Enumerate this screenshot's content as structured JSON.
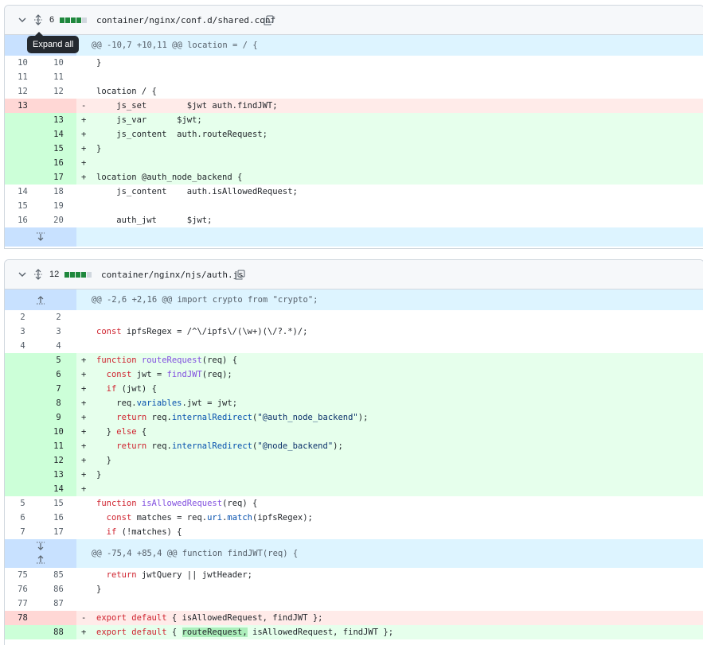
{
  "files": [
    {
      "changes": "6",
      "bars": [
        1,
        1,
        1,
        1,
        0
      ],
      "path": "container/nginx/conf.d/shared.conf",
      "tooltip": "Expand all",
      "rows": [
        {
          "type": "hunk",
          "left": "",
          "right": "",
          "sign": "",
          "code": "@@ -10,7 +10,11 @@ location = / {",
          "gutter_icon": "expand-up-icon"
        },
        {
          "type": "ctx",
          "left": "10",
          "right": "10",
          "sign": " ",
          "code": "}"
        },
        {
          "type": "ctx",
          "left": "11",
          "right": "11",
          "sign": " ",
          "code": ""
        },
        {
          "type": "ctx",
          "left": "12",
          "right": "12",
          "sign": " ",
          "code": "location / {"
        },
        {
          "type": "del",
          "left": "13",
          "right": "",
          "sign": "-",
          "code": "    js_set        $jwt auth.findJWT;"
        },
        {
          "type": "add",
          "left": "",
          "right": "13",
          "sign": "+",
          "code": "    js_var      $jwt;"
        },
        {
          "type": "add",
          "left": "",
          "right": "14",
          "sign": "+",
          "code": "    js_content  auth.routeRequest;"
        },
        {
          "type": "add",
          "left": "",
          "right": "15",
          "sign": "+",
          "code": "}"
        },
        {
          "type": "add",
          "left": "",
          "right": "16",
          "sign": "+",
          "code": ""
        },
        {
          "type": "add",
          "left": "",
          "right": "17",
          "sign": "+",
          "code": "location @auth_node_backend {"
        },
        {
          "type": "ctx",
          "left": "14",
          "right": "18",
          "sign": " ",
          "code": "    js_content    auth.isAllowedRequest;"
        },
        {
          "type": "ctx",
          "left": "15",
          "right": "19",
          "sign": " ",
          "code": ""
        },
        {
          "type": "ctx",
          "left": "16",
          "right": "20",
          "sign": " ",
          "code": "    auth_jwt      $jwt;"
        },
        {
          "type": "hunk",
          "left": "",
          "right": "",
          "sign": "",
          "code": "",
          "gutter_icon": "expand-down-icon"
        }
      ]
    },
    {
      "changes": "12",
      "bars": [
        1,
        1,
        1,
        1,
        0
      ],
      "path": "container/nginx/njs/auth.js",
      "rows": [
        {
          "type": "hunk",
          "left": "",
          "right": "",
          "sign": "",
          "code": "@@ -2,6 +2,16 @@ import crypto from \"crypto\";",
          "gutter_icon": "expand-up-icon"
        },
        {
          "type": "ctx",
          "left": "2",
          "right": "2",
          "sign": " ",
          "code": ""
        },
        {
          "type": "ctx",
          "left": "3",
          "right": "3",
          "sign": " ",
          "code": "const ipfsRegex = /^\\/ipfs\\/(\\w+)(\\/?.*)/;"
        },
        {
          "type": "ctx",
          "left": "4",
          "right": "4",
          "sign": " ",
          "code": ""
        },
        {
          "type": "add",
          "left": "",
          "right": "5",
          "sign": "+",
          "code": "function routeRequest(req) {"
        },
        {
          "type": "add",
          "left": "",
          "right": "6",
          "sign": "+",
          "code": "  const jwt = findJWT(req);"
        },
        {
          "type": "add",
          "left": "",
          "right": "7",
          "sign": "+",
          "code": "  if (jwt) {"
        },
        {
          "type": "add",
          "left": "",
          "right": "8",
          "sign": "+",
          "code": "    req.variables.jwt = jwt;"
        },
        {
          "type": "add",
          "left": "",
          "right": "9",
          "sign": "+",
          "code": "    return req.internalRedirect(\"@auth_node_backend\");"
        },
        {
          "type": "add",
          "left": "",
          "right": "10",
          "sign": "+",
          "code": "  } else {"
        },
        {
          "type": "add",
          "left": "",
          "right": "11",
          "sign": "+",
          "code": "    return req.internalRedirect(\"@node_backend\");"
        },
        {
          "type": "add",
          "left": "",
          "right": "12",
          "sign": "+",
          "code": "  }"
        },
        {
          "type": "add",
          "left": "",
          "right": "13",
          "sign": "+",
          "code": "}"
        },
        {
          "type": "add",
          "left": "",
          "right": "14",
          "sign": "+",
          "code": ""
        },
        {
          "type": "ctx",
          "left": "5",
          "right": "15",
          "sign": " ",
          "code": "function isAllowedRequest(req) {"
        },
        {
          "type": "ctx",
          "left": "6",
          "right": "16",
          "sign": " ",
          "code": "  const matches = req.uri.match(ipfsRegex);"
        },
        {
          "type": "ctx",
          "left": "7",
          "right": "17",
          "sign": " ",
          "code": "  if (!matches) {"
        },
        {
          "type": "hunk",
          "left": "",
          "right": "",
          "sign": "",
          "code": "@@ -75,4 +85,4 @@ function findJWT(req) {",
          "gutter_icon": "expand-both-icon",
          "tall": true
        },
        {
          "type": "ctx",
          "left": "75",
          "right": "85",
          "sign": " ",
          "code": "  return jwtQuery || jwtHeader;"
        },
        {
          "type": "ctx",
          "left": "76",
          "right": "86",
          "sign": " ",
          "code": "}"
        },
        {
          "type": "ctx",
          "left": "77",
          "right": "87",
          "sign": " ",
          "code": ""
        },
        {
          "type": "del",
          "left": "78",
          "right": "",
          "sign": "-",
          "code": "export default { isAllowedRequest, findJWT };"
        },
        {
          "type": "add",
          "left": "",
          "right": "88",
          "sign": "+",
          "code": "export default { routeRequest, isAllowedRequest, findJWT };",
          "highlight": "routeRequest,"
        }
      ]
    }
  ],
  "colors": {
    "added": "#1f883d",
    "deleted": "#cf222e",
    "hunk": "#ddf4ff"
  }
}
